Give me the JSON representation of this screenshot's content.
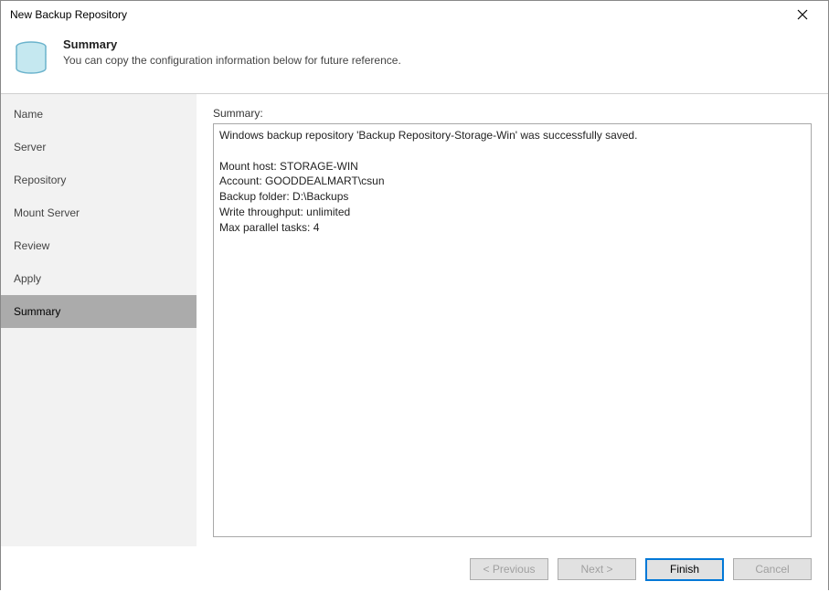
{
  "window": {
    "title": "New Backup Repository"
  },
  "header": {
    "title": "Summary",
    "subtitle": "You can copy the configuration information below for future reference."
  },
  "sidebar": {
    "items": [
      {
        "label": "Name",
        "selected": false
      },
      {
        "label": "Server",
        "selected": false
      },
      {
        "label": "Repository",
        "selected": false
      },
      {
        "label": "Mount Server",
        "selected": false
      },
      {
        "label": "Review",
        "selected": false
      },
      {
        "label": "Apply",
        "selected": false
      },
      {
        "label": "Summary",
        "selected": true
      }
    ]
  },
  "main": {
    "summary_label": "Summary:",
    "summary_text": "Windows backup repository 'Backup Repository-Storage-Win' was successfully saved.\n\nMount host: STORAGE-WIN\nAccount: GOODDEALMART\\csun\nBackup folder: D:\\Backups\nWrite throughput: unlimited\nMax parallel tasks: 4"
  },
  "footer": {
    "previous": "< Previous",
    "next": "Next >",
    "finish": "Finish",
    "cancel": "Cancel"
  }
}
